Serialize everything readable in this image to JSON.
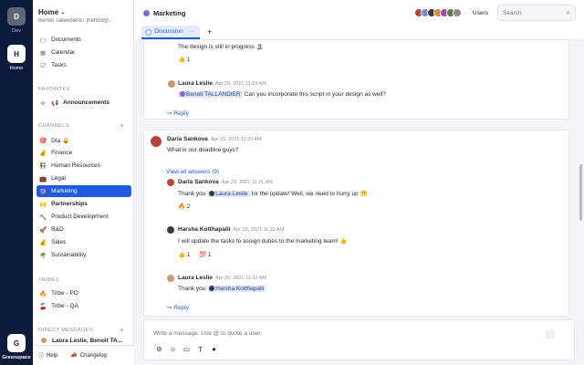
{
  "rail": {
    "workspaces": [
      {
        "initial": "D",
        "label": "Dev"
      },
      {
        "initial": "H",
        "label": "Home"
      }
    ],
    "brand_initial": "G",
    "brand_label": "Greenspace"
  },
  "sidebar": {
    "workspace_title": "Home",
    "user": "Benoit Tallendier87 [heho3@...",
    "top_items": [
      {
        "label": "Documents",
        "icon": "document-icon"
      },
      {
        "label": "Calendar",
        "icon": "calendar-icon"
      },
      {
        "label": "Tasks",
        "icon": "tasks-icon"
      }
    ],
    "favorites_heading": "FAVORITES",
    "favorites": [
      {
        "label": "Announcements",
        "emoji": "📢"
      }
    ],
    "channels_heading": "CHANNELS",
    "channels": [
      {
        "label": "Dta 🔒",
        "emoji": "🎯"
      },
      {
        "label": "Finance",
        "emoji": "💰"
      },
      {
        "label": "Human Resources",
        "emoji": "👫"
      },
      {
        "label": "Legal",
        "emoji": "💼"
      },
      {
        "label": "Marketing",
        "emoji": "🔮",
        "active": true
      },
      {
        "label": "Partnerships",
        "emoji": "🙌",
        "bold": true
      },
      {
        "label": "Product Development",
        "emoji": "🔨"
      },
      {
        "label": "R&D",
        "emoji": "🚀"
      },
      {
        "label": "Sales",
        "emoji": "💰"
      },
      {
        "label": "Sustainability",
        "emoji": "🌴"
      }
    ],
    "tribes_heading": "TRIBES",
    "tribes": [
      {
        "label": "Tribe - PO",
        "emoji": "🔥"
      },
      {
        "label": "Tribe - QA",
        "emoji": "🍒"
      }
    ],
    "dm_heading": "DIRECT MESSAGES",
    "dm_item": "Laura Leslie, Benoit TA...",
    "footer": {
      "help": "Help",
      "changelog": "Changelog"
    }
  },
  "header": {
    "channel": "Marketing",
    "users_label": "Users",
    "search_placeholder": "Search",
    "avatar_colors": [
      "#b8453a",
      "#6b8fd6",
      "#3a3a3a",
      "#d68b4a",
      "#a74f9c",
      "#5a7b53",
      "#8a8a8a"
    ]
  },
  "tabs": {
    "active": "Discussion",
    "more": "···",
    "add": "+"
  },
  "thread1": {
    "progress_text": "The design is still in progress 🏝",
    "progress_reaction": "👍 1",
    "reply": {
      "author": "Laura Leslie",
      "time": "Apr 29, 2021 11:29 AM",
      "mention": "Benoit TALLANDIER",
      "text": "Can you incorporate this script in your design as well?"
    },
    "reply_link": "↪ Reply"
  },
  "thread2": {
    "author": "Daria Sankova",
    "time": "Apr 29, 2021 11:29 AM",
    "text": "What is our deadline guys?",
    "view_answers": "View all answers (9)",
    "r1": {
      "author": "Daria Sankova",
      "time": "Apr 29, 2021 11:31 AM",
      "pre": "Thank you",
      "mention": "Laura Leslie",
      "post": "for the update! Well, we need to hurry up 😬",
      "reaction": "🔥 2"
    },
    "r2": {
      "author": "Harsha Kotthapalli",
      "time": "Apr 29, 2021 11:32 AM",
      "text": "I will update the tasks to assign duties to the marketing team! 👍",
      "reaction1": "👍 1",
      "reaction2": "💯 1"
    },
    "r3": {
      "author": "Laura Leslie",
      "time": "Apr 29, 2021 11:32 AM",
      "pre": "Thank you",
      "mention": "Harsha Kotthapalli"
    },
    "reply_link": "↪ Reply"
  },
  "composer": {
    "placeholder": "Write a message. Use @ to quote a user."
  }
}
